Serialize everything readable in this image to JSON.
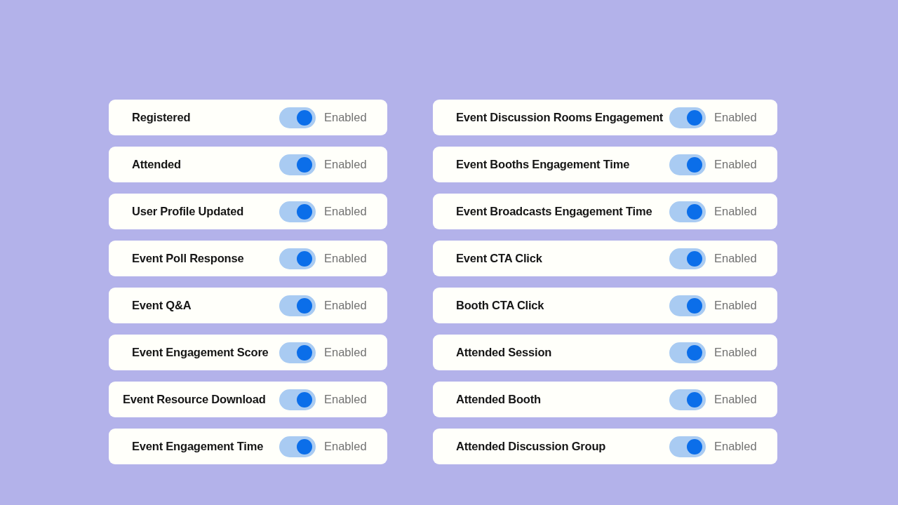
{
  "columns": [
    {
      "items": [
        {
          "label": "Registered",
          "on": true,
          "status": "Enabled"
        },
        {
          "label": "Attended",
          "on": true,
          "status": "Enabled"
        },
        {
          "label": "User Profile Updated",
          "on": true,
          "status": "Enabled"
        },
        {
          "label": "Event Poll Response",
          "on": true,
          "status": "Enabled"
        },
        {
          "label": "Event Q&A",
          "on": true,
          "status": "Enabled"
        },
        {
          "label": "Event Engagement Score",
          "on": true,
          "status": "Enabled"
        },
        {
          "label": "Event Resource Download",
          "on": true,
          "status": "Enabled"
        },
        {
          "label": "Event Engagement Time",
          "on": true,
          "status": "Enabled"
        }
      ]
    },
    {
      "items": [
        {
          "label": "Event Discussion Rooms Engagement",
          "on": true,
          "status": "Enabled"
        },
        {
          "label": "Event Booths Engagement Time",
          "on": true,
          "status": "Enabled"
        },
        {
          "label": "Event Broadcasts Engagement Time",
          "on": true,
          "status": "Enabled"
        },
        {
          "label": "Event CTA Click",
          "on": true,
          "status": "Enabled"
        },
        {
          "label": "Booth CTA Click",
          "on": true,
          "status": "Enabled"
        },
        {
          "label": "Attended Session",
          "on": true,
          "status": "Enabled"
        },
        {
          "label": "Attended Booth",
          "on": true,
          "status": "Enabled"
        },
        {
          "label": "Attended Discussion Group",
          "on": true,
          "status": "Enabled"
        }
      ]
    }
  ]
}
